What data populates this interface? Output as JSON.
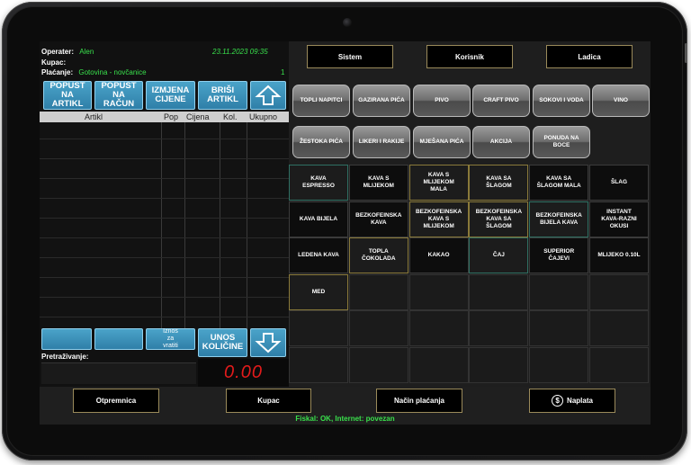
{
  "header": {
    "operater_label": "Operater:",
    "operater_value": "Alen",
    "datetime": "23.11.2023 09:35",
    "kupac_label": "Kupac:",
    "placanje_label": "Plaćanje:",
    "placanje_value": "Gotovina - novčanice",
    "count": "1"
  },
  "left_buttons": {
    "popust_artikl": "POPUST\nNA\nARTIKL",
    "popust_racun": "POPUST\nNA\nRAČUN",
    "izmjena_cijene": "IZMJENA\nCIJENE",
    "brisi_artikl": "BRIŠI\nARTIKL",
    "iznos_za_vratiti": "Iznos\nza\nvratiti",
    "unos_kolicine": "UNOS\nKOLIČINE"
  },
  "table": {
    "columns": [
      "Artikl",
      "Pop",
      "Cijena",
      "Kol.",
      "Ukupno"
    ]
  },
  "search": {
    "label": "Pretraživanje:"
  },
  "total": "0.00",
  "top_buttons": [
    "Sistem",
    "Korisnik",
    "Ladica"
  ],
  "categories": [
    "TOPLI NAPITCI",
    "GAZIRANA PIĆA",
    "PIVO",
    "CRAFT PIVO",
    "SOKOVI I VODA",
    "VINO",
    "ŽESTOKA PIĆA",
    "LIKERI I RAKIJE",
    "MJEŠANA PIĆA",
    "AKCIJA",
    "PONUDA NA\nBOCE"
  ],
  "products": [
    "KAVA\nESPRESSO",
    "KAVA S\nMLIJEKOM",
    "KAVA S\nMLIJEKOM\nMALA",
    "KAVA SA\nŠLAGOM",
    "KAVA SA\nŠLAGOM MALA",
    "ŠLAG",
    "KAVA BIJELA",
    "BEZKOFEINSKA\nKAVA",
    "BEZKOFEINSKA\nKAVA S\nMLIJEKOM",
    "BEZKOFEINSKA\nKAVA SA\nŠLAGOM",
    "BEZKOFEINSKA\nBIJELA KAVA",
    "INSTANT\nKAVA-RAZNI\nOKUSI",
    "LEDENA KAVA",
    "TOPLA\nČOKOLADA",
    "KAKAO",
    "ČAJ",
    "SUPERIOR\nČAJEVI",
    "MLIJEKO 0.10L",
    "MED"
  ],
  "bottom_buttons": {
    "otpremnica": "Otpremnica",
    "kupac": "Kupac",
    "nacin_placanja": "Način plaćanja",
    "naplata": "Naplata"
  },
  "status": "Fiskal: OK, Internet: povezan",
  "icons": {
    "arrow_up": "arrow-up-icon",
    "arrow_down": "arrow-down-icon",
    "dollar": "dollar-icon",
    "dollar_glyph": "$"
  },
  "colors": {
    "accent_blue": "#2f7fa8",
    "status_green": "#39e04c",
    "total_red": "#e21b1b",
    "button_border_gold": "#9a8a5a"
  }
}
